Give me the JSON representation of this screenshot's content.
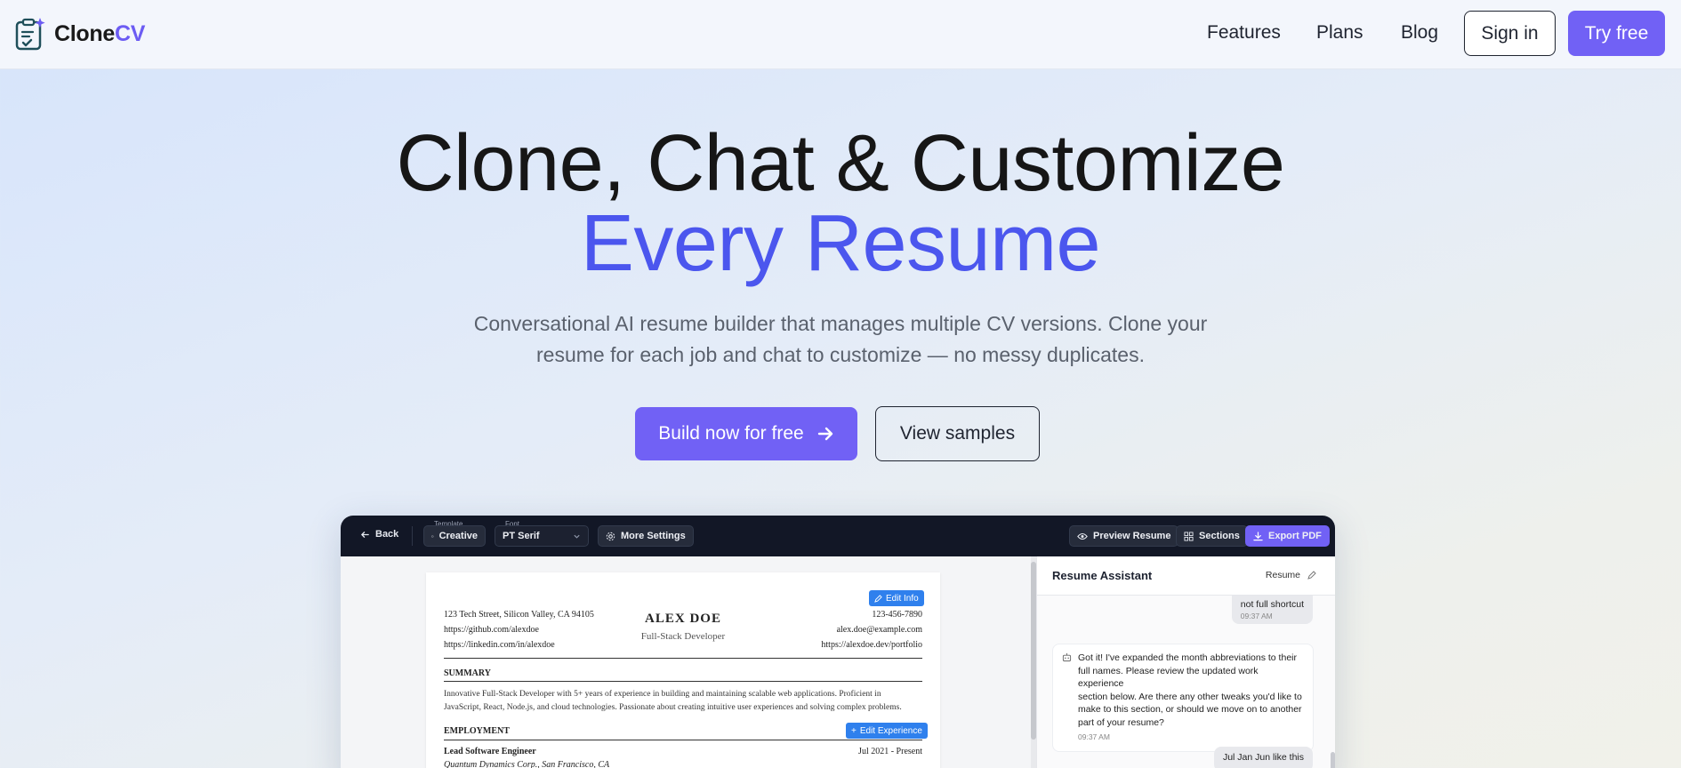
{
  "brand": {
    "name_part1": "Clone",
    "name_part2": "CV"
  },
  "nav": {
    "links": [
      "Features",
      "Plans",
      "Blog"
    ],
    "signin_label": "Sign in",
    "try_label": "Try free"
  },
  "hero": {
    "title_line1": "Clone, Chat & Customize",
    "title_line2": "Every Resume",
    "subtitle_line1": "Conversational AI resume builder that manages multiple CV versions. Clone your",
    "subtitle_line2": "resume for each job and chat to customize — no messy duplicates.",
    "primary_cta": "Build now for free",
    "secondary_cta": "View samples"
  },
  "toolbar": {
    "back_label": "Back",
    "template_caption": "Template",
    "template_value": "Creative",
    "font_caption": "Font",
    "font_value": "PT Serif",
    "more_settings_label": "More Settings",
    "preview_label": "Preview Resume",
    "sections_label": "Sections",
    "export_label": "Export PDF"
  },
  "resume": {
    "edit_info_label": "Edit Info",
    "address": "123 Tech Street, Silicon Valley, CA 94105",
    "github": "https://github.com/alexdoe",
    "linkedin": "https://linkedin.com/in/alexdoe",
    "name": "ALEX DOE",
    "role": "Full-Stack Developer",
    "phone": "123-456-7890",
    "email": "alex.doe@example.com",
    "website": "https://alexdoe.dev/portfolio",
    "summary_heading": "SUMMARY",
    "summary_line1": "Innovative Full-Stack Developer with 5+ years of experience in building and maintaining scalable web applications. Proficient in",
    "summary_line2": "JavaScript, React, Node.js, and cloud technologies. Passionate about creating intuitive user experiences and solving complex problems.",
    "employment_heading": "EMPLOYMENT",
    "edit_experience_label": "Edit Experience",
    "job_title": "Lead Software Engineer",
    "job_dates": "Jul 2021 - Present",
    "job_company": "Quantum Dynamics Corp., San Francisco, CA"
  },
  "assistant": {
    "title": "Resume Assistant",
    "tag": "Resume",
    "messages": [
      {
        "text": "not full shortcut",
        "time": "09:37 AM"
      },
      {
        "text_line1": "Got it! I've expanded the month abbreviations to their",
        "text_line2": "full names. Please review the updated work experience",
        "text_line3": "section below. Are there any other tweaks you'd like to",
        "text_line4": "make to this section, or should we move on to another",
        "text_line5": "part of your resume?",
        "time": "09:37 AM"
      },
      {
        "text": "Jul Jan Jun like this"
      }
    ]
  },
  "colors": {
    "accent": "#7161f5",
    "hero_blue": "#4b56ee",
    "toolbar_bg": "#121726",
    "edit_btn": "#2f80ed"
  }
}
